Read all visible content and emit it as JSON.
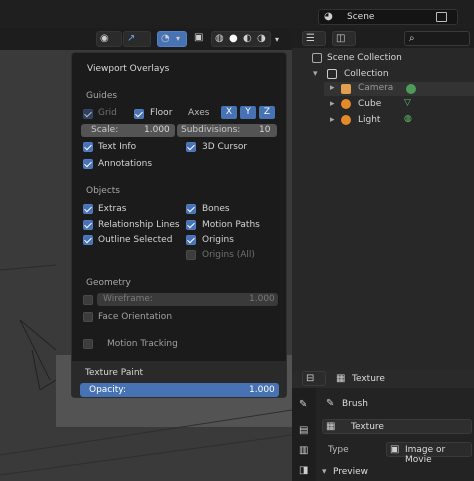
{
  "topbar": {
    "scene_label": "Scene"
  },
  "overlay": {
    "title": "Viewport Overlays",
    "guides": {
      "section_label": "Guides",
      "grid_label": "Grid",
      "floor_label": "Floor",
      "axes_label": "Axes",
      "axis_x": "X",
      "axis_y": "Y",
      "axis_z": "Z",
      "scale_label": "Scale:",
      "scale_value": "1.000",
      "subdivisions_label": "Subdivisions:",
      "subdivisions_value": "10",
      "text_info_label": "Text Info",
      "cursor_label": "3D Cursor",
      "annotations_label": "Annotations"
    },
    "objects": {
      "section_label": "Objects",
      "extras_label": "Extras",
      "bones_label": "Bones",
      "relationship_lines_label": "Relationship Lines",
      "motion_paths_label": "Motion Paths",
      "outline_selected_label": "Outline Selected",
      "origins_label": "Origins",
      "origins_all_label": "Origins (All)"
    },
    "geometry": {
      "section_label": "Geometry",
      "wireframe_label": "Wireframe:",
      "wireframe_value": "1.000",
      "face_orientation_label": "Face Orientation",
      "motion_tracking_label": "Motion Tracking"
    },
    "texture_paint": {
      "section_label": "Texture Paint",
      "opacity_label": "Opacity:",
      "opacity_value": "1.000"
    }
  },
  "outliner": {
    "scene_collection_label": "Scene Collection",
    "collection_label": "Collection",
    "camera_label": "Camera",
    "cube_label": "Cube",
    "light_label": "Light"
  },
  "properties": {
    "texture_header_label": "Texture",
    "brush_label": "Brush",
    "texture_field_label": "Texture",
    "type_label": "Type",
    "type_value": "Image or Movie",
    "preview_label": "Preview"
  },
  "colors": {
    "accent": "#4772b3",
    "panel": "#1b1b1b",
    "viewport": "#393939"
  }
}
